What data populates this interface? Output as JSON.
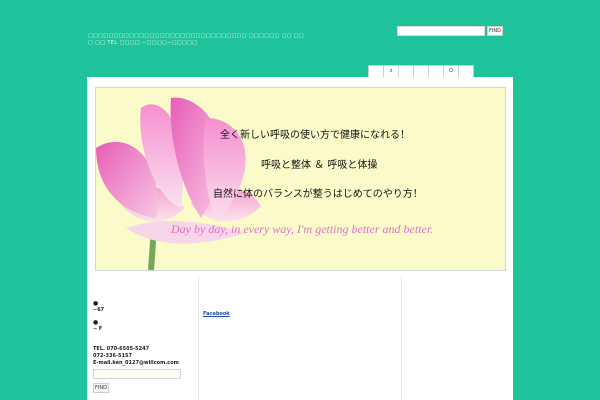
{
  "header": {
    "site_text": "□□□□□□□□□□□□□□□□□□□□□□□□□□□□□□□ □□□□□□ □□ □□□ □□ TEL □□□□ −□□□□−□□□□□",
    "search_placeholder": "",
    "search_button": "FIND"
  },
  "nav": {
    "tabs": [
      "",
      "z",
      "",
      "",
      "",
      "O",
      ""
    ]
  },
  "banner": {
    "line1": "全く新しい呼吸の使い方で健康になれる！",
    "line2": "呼吸と整体 ＆ 呼吸と体操",
    "line3": "自然に体のバランスが整うはじめてのやり方！",
    "motto": "Day by day, in every way, I'm getting better and better."
  },
  "sidebar": {
    "bullet1": "●",
    "item1": "−67",
    "bullet2": "●",
    "item2": "− F",
    "tel": "TEL. 070-6505-5247",
    "phone2": "072-336-5157",
    "email": "E-mail.ken_0127@willcom.com",
    "find_button": "FIND"
  },
  "content": {
    "facebook_link": "Facebook"
  },
  "colors": {
    "background": "#1fc39b",
    "banner_bg": "#fbfbca",
    "motto": "#e070c8",
    "link": "#1a4ea8"
  }
}
